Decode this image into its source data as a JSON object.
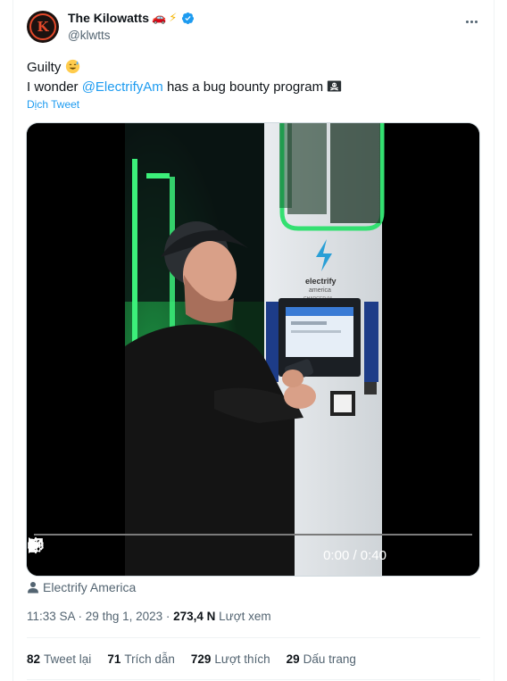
{
  "author": {
    "display_name": "The Kilowatts",
    "handle": "@klwtts",
    "avatar_letter": "K"
  },
  "tweet": {
    "line1": "Guilty ",
    "line2_prefix": "I wonder ",
    "mention": "@ElectrifyAm",
    "line2_suffix": " has a bug bounty program ",
    "translate_label": "Dịch Tweet"
  },
  "video": {
    "time": "0:00 / 0:40",
    "progress": 0,
    "brand_text": "electrify",
    "brand_sub": "america",
    "charger_label": "CHARGER 04"
  },
  "source": {
    "label": "Electrify America"
  },
  "meta": {
    "time": "11:33 SA",
    "separator1": " · ",
    "date": "29 thg 1, 2023",
    "separator2": " · ",
    "views_count": "273,4 N",
    "views_label": " Lượt xem"
  },
  "stats": [
    {
      "count": "82",
      "label": "Tweet lại"
    },
    {
      "count": "71",
      "label": "Trích dẫn"
    },
    {
      "count": "729",
      "label": "Lượt thích"
    },
    {
      "count": "29",
      "label": "Dấu trang"
    }
  ],
  "colors": {
    "accent": "#1d9bf0",
    "text": "#0f1419",
    "muted": "#536471",
    "neon_green": "#2bd96b"
  }
}
